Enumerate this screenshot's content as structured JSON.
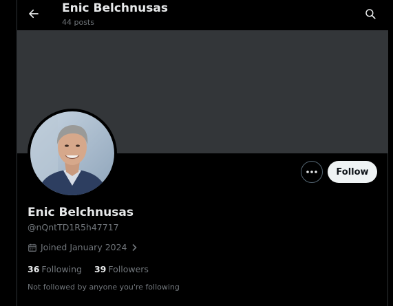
{
  "header": {
    "title": "Enic Belchnusas",
    "subtitle": "44 posts",
    "back_icon": "arrow-left-icon",
    "search_icon": "search-icon"
  },
  "profile": {
    "display_name": "Enic Belchnusas",
    "handle": "@nQntTD1R5h47717",
    "joined": "Joined January 2024",
    "following_count": "36",
    "following_label": "Following",
    "followers_count": "39",
    "followers_label": "Followers",
    "not_followed_text": "Not followed by anyone you're following"
  },
  "actions": {
    "more_icon": "more-options-icon",
    "follow_label": "Follow"
  },
  "colors": {
    "background": "#000000",
    "banner": "#333639",
    "primary_text": "#e7e9ea",
    "secondary_text": "#71767b",
    "follow_button_bg": "#eff3f4"
  }
}
